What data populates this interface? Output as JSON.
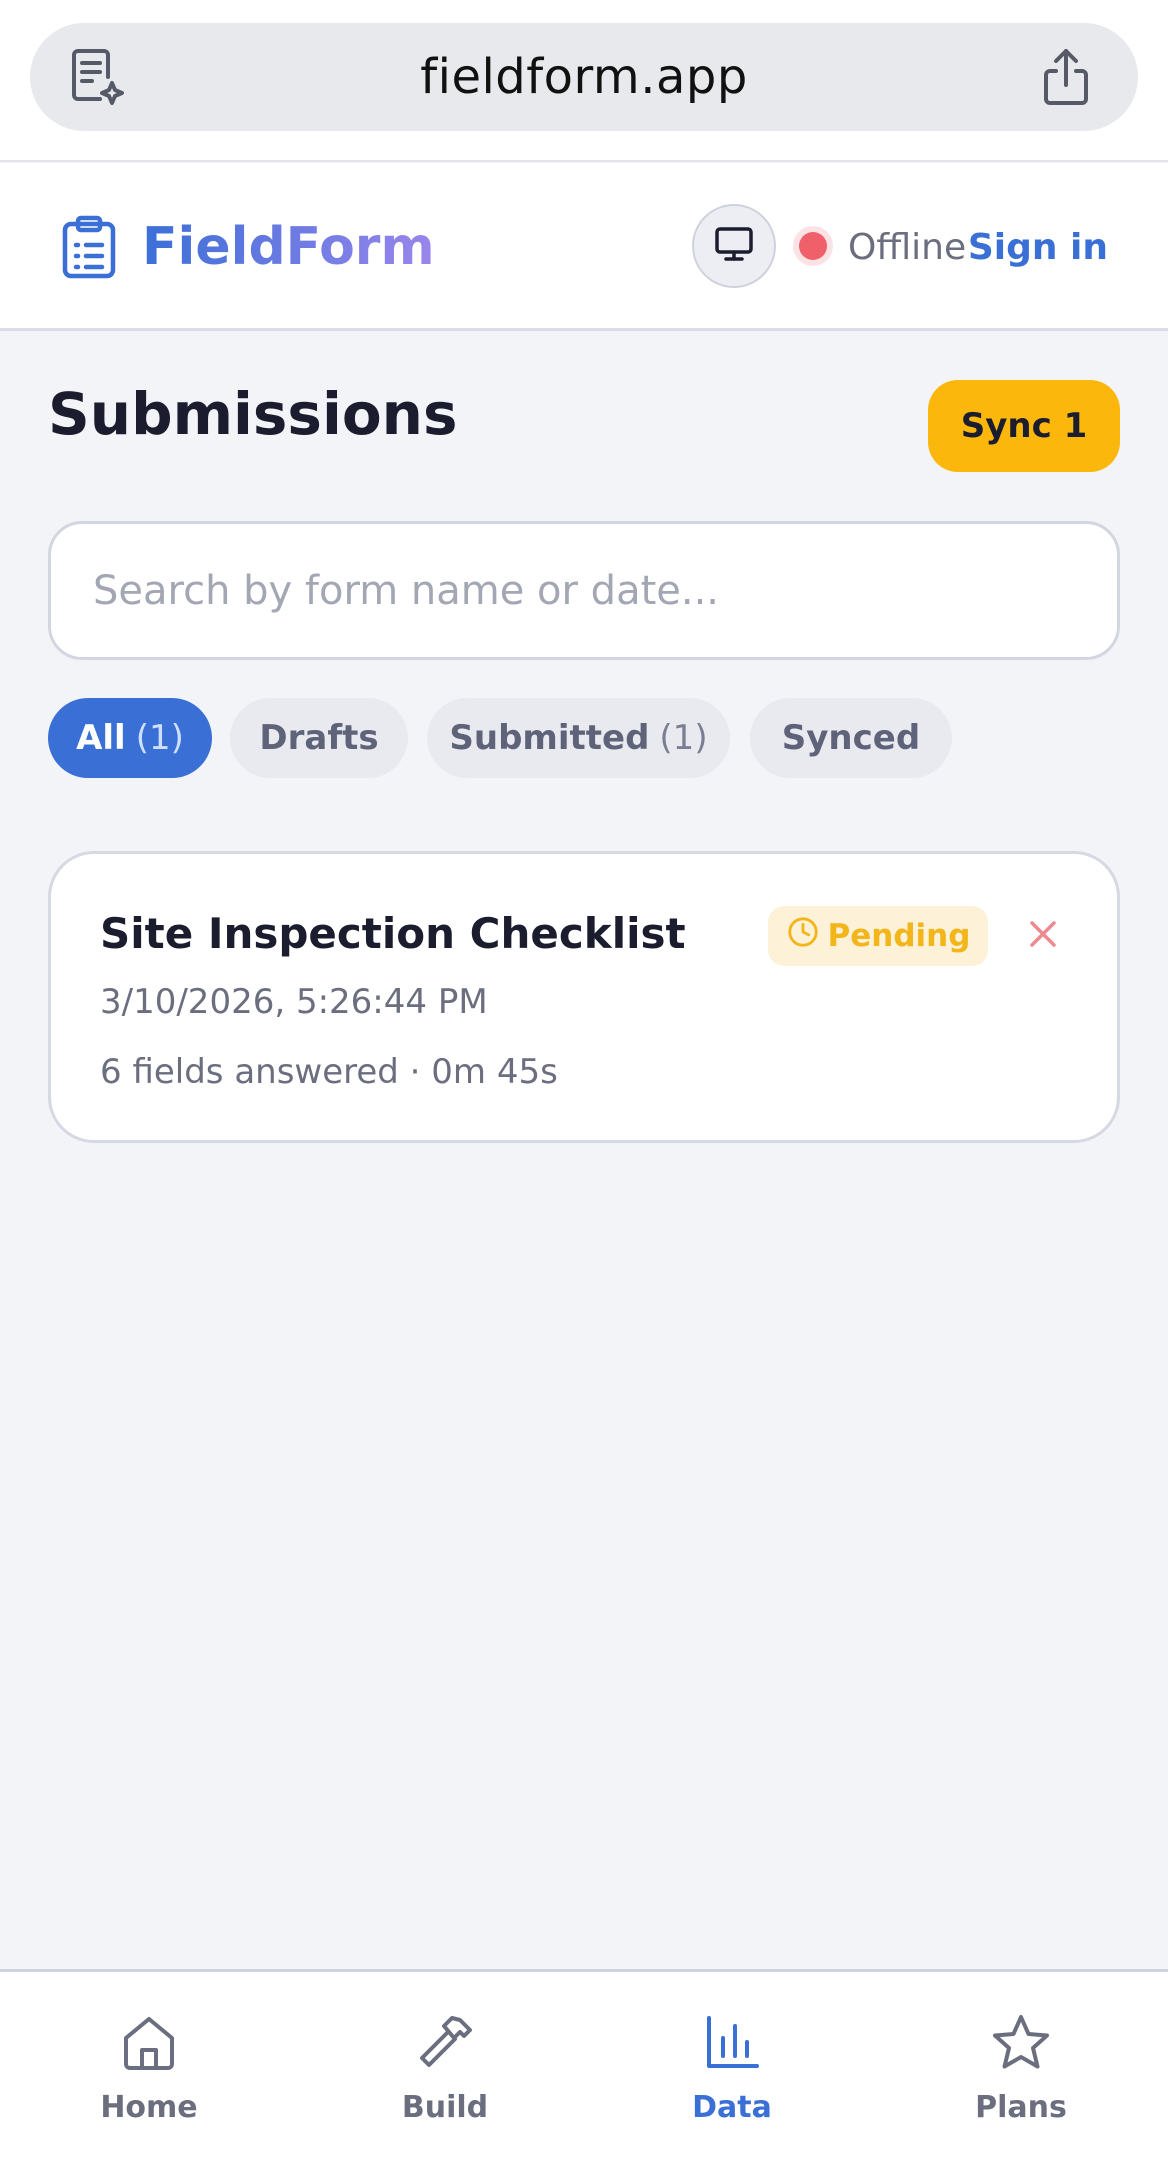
{
  "browser": {
    "url": "fieldform.app",
    "left_icon": "document-sparkle-icon",
    "right_icon": "share-icon"
  },
  "header": {
    "brand": "FieldForm",
    "status": "Offline",
    "status_color": "#f0606b",
    "sign_in": "Sign in",
    "accent": "#3a6fd6"
  },
  "page": {
    "title": "Submissions",
    "sync_label": "Sync 1",
    "sync_color": "#fbb70c"
  },
  "search": {
    "placeholder": "Search by form name or date...",
    "value": ""
  },
  "filters": [
    {
      "label": "All",
      "count": "(1)",
      "active": true
    },
    {
      "label": "Drafts",
      "count": "",
      "active": false
    },
    {
      "label": "Submitted",
      "count": "(1)",
      "active": false
    },
    {
      "label": "Synced",
      "count": "",
      "active": false
    }
  ],
  "submissions": [
    {
      "title": "Site Inspection Checklist",
      "datetime": "3/10/2026, 5:26:44 PM",
      "meta": "6 fields answered · 0m 45s",
      "status": "Pending",
      "status_color": "#f2b51a"
    }
  ],
  "nav": {
    "items": [
      {
        "label": "Home",
        "icon": "home-icon",
        "active": false
      },
      {
        "label": "Build",
        "icon": "hammer-icon",
        "active": false
      },
      {
        "label": "Data",
        "icon": "bar-chart-icon",
        "active": true
      },
      {
        "label": "Plans",
        "icon": "star-icon",
        "active": false
      }
    ]
  }
}
